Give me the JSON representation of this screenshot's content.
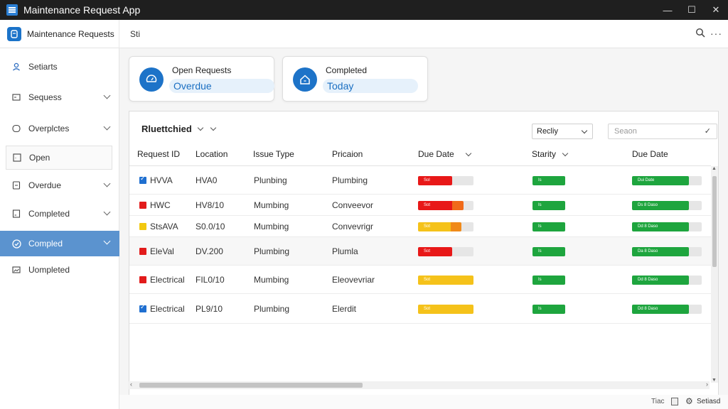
{
  "window": {
    "title": "Maintenance Request App",
    "controls": [
      "—",
      "☐",
      "✕"
    ]
  },
  "header": {
    "app_label": "Maintenance Requests",
    "breadcrumb": "Sti",
    "more": "···"
  },
  "sidebar": {
    "items": [
      {
        "label": "Setiarts",
        "icon": "user-icon"
      },
      {
        "label": "Sequess",
        "icon": "list-icon"
      },
      {
        "label": "Overplctes",
        "icon": "clock-icon"
      },
      {
        "label": "Open",
        "icon": "square-icon"
      },
      {
        "label": "Overdue",
        "icon": "clipboard-icon"
      },
      {
        "label": "Completed",
        "icon": "document-icon"
      },
      {
        "label": "Compled",
        "icon": "check-circle-icon"
      },
      {
        "label": "Uompleted",
        "icon": "image-icon"
      }
    ]
  },
  "cards": [
    {
      "title": "Open Requests",
      "value": "Overdue",
      "icon": "gauge-icon"
    },
    {
      "title": "Completed",
      "value": "Today",
      "icon": "home-icon"
    }
  ],
  "panel": {
    "title": "Rluettchied",
    "filter_value": "Recliy",
    "search_placeholder": "Seaon",
    "columns": [
      "Request ID",
      "Location",
      "Issue Type",
      "Pricaion",
      "Due Date",
      "Starity",
      "Due Date"
    ],
    "rows": [
      {
        "id": "HVVA",
        "location": "HVA0",
        "issue": "Plunbing",
        "priority": "Plumbing",
        "mark_color": "#1f6fd0",
        "mark_checked": true,
        "due": {
          "fill": 0.62,
          "color": "#e81818",
          "label": "Sol"
        },
        "severity": {
          "fill": 1.0,
          "color": "#1ea53e",
          "label": "Is"
        },
        "due2": {
          "fill": 0.82,
          "color": "#1ea53e",
          "label": "Dui Date"
        }
      },
      {
        "id": "HWC",
        "location": "HV8/10",
        "issue": "Mumbing",
        "priority": "Conveevor",
        "mark_color": "#e21b1b",
        "mark_checked": false,
        "due": {
          "fill": 0.82,
          "color": "#e81818",
          "label": "Sot",
          "tail": "#f06a1a"
        },
        "severity": {
          "fill": 1.0,
          "color": "#1ea53e",
          "label": "Is"
        },
        "due2": {
          "fill": 0.82,
          "color": "#1ea53e",
          "label": "Ds 8 Daso"
        }
      },
      {
        "id": "StsAVA",
        "location": "S0.0/10",
        "issue": "Mumbing",
        "priority": "Convevrigr",
        "mark_color": "#f2c80f",
        "mark_checked": false,
        "due": {
          "fill": 0.78,
          "color": "#f5c21a",
          "label": "Sot",
          "tail": "#f08a1a"
        },
        "severity": {
          "fill": 1.0,
          "color": "#1ea53e",
          "label": "Is"
        },
        "due2": {
          "fill": 0.82,
          "color": "#1ea53e",
          "label": "Dd 8 Daso"
        }
      },
      {
        "id": "EleVal",
        "location": "DV.200",
        "issue": "Plumbing",
        "priority": "Plumla",
        "mark_color": "#e21b1b",
        "mark_checked": false,
        "due": {
          "fill": 0.62,
          "color": "#e81818",
          "label": "Sot"
        },
        "severity": {
          "fill": 1.0,
          "color": "#1ea53e",
          "label": "Is"
        },
        "due2": {
          "fill": 0.82,
          "color": "#1ea53e",
          "label": "Da 8 Daso"
        }
      },
      {
        "id": "Electrical",
        "location": "FIL0/10",
        "issue": "Mumbing",
        "priority": "Eleovevriar",
        "mark_color": "#e21b1b",
        "mark_checked": false,
        "due": {
          "fill": 1.0,
          "color": "#f5c21a",
          "label": "Sot"
        },
        "severity": {
          "fill": 1.0,
          "color": "#1ea53e",
          "label": "Is"
        },
        "due2": {
          "fill": 0.82,
          "color": "#1ea53e",
          "label": "Dd 8 Daso"
        }
      },
      {
        "id": "Electrical",
        "location": "PL9/10",
        "issue": "Plumbing",
        "priority": "Elerdit",
        "mark_color": "#1f6fd0",
        "mark_checked": true,
        "due": {
          "fill": 1.0,
          "color": "#f5c21a",
          "label": "Sot"
        },
        "severity": {
          "fill": 1.0,
          "color": "#1ea53e",
          "label": "Is"
        },
        "due2": {
          "fill": 0.82,
          "color": "#1ea53e",
          "label": "Dd 8 Daso"
        }
      }
    ]
  },
  "statusbar": {
    "left_text": "Tiac",
    "right_text": "Setiasd"
  }
}
